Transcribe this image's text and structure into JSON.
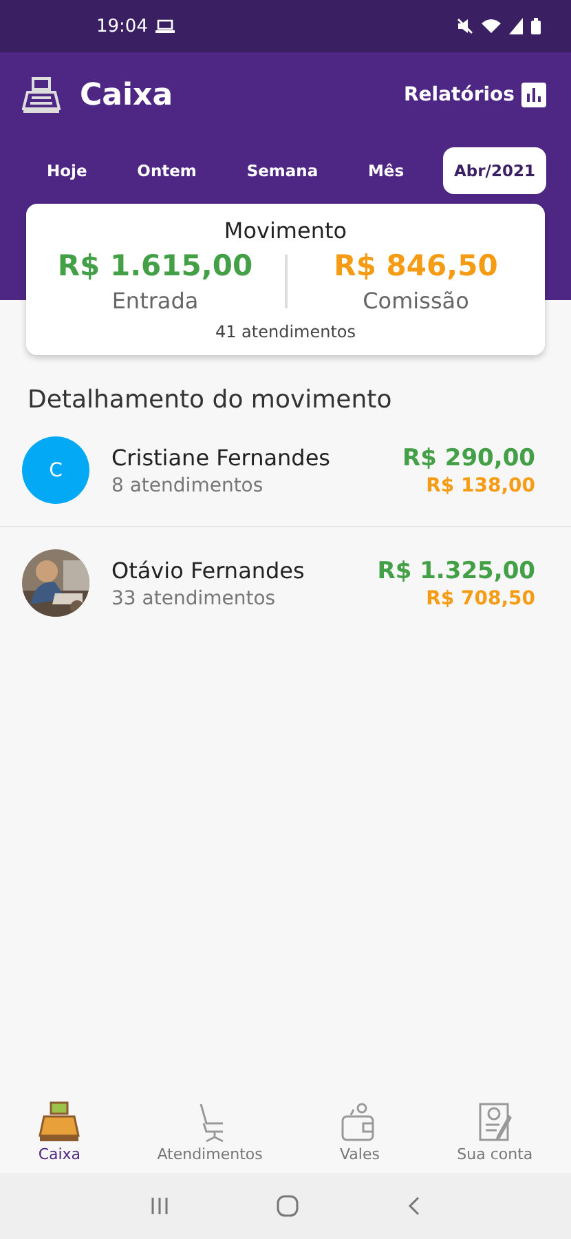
{
  "status_bar": {
    "time": "19:04"
  },
  "header": {
    "title": "Caixa",
    "reports_label": "Relatórios"
  },
  "tabs": [
    {
      "label": "Hoje",
      "selected": false
    },
    {
      "label": "Ontem",
      "selected": false
    },
    {
      "label": "Semana",
      "selected": false
    },
    {
      "label": "Mês",
      "selected": false
    },
    {
      "label": "Abr/2021",
      "selected": true
    }
  ],
  "summary": {
    "title": "Movimento",
    "income": "R$ 1.615,00",
    "income_label": "Entrada",
    "commission": "R$ 846,50",
    "commission_label": "Comissão",
    "count": "41 atendimentos"
  },
  "section_title": "Detalhamento do movimento",
  "professionals": [
    {
      "kind": "initial",
      "initial": "C",
      "color": "#03a9f4",
      "name": "Cristiane Fernandes",
      "count": "8 atendimentos",
      "income": "R$ 290,00",
      "commission": "R$ 138,00"
    },
    {
      "kind": "picture",
      "name": "Otávio Fernandes",
      "count": "33 atendimentos",
      "income": "R$ 1.325,00",
      "commission": "R$ 708,50"
    }
  ],
  "bottom_nav": [
    {
      "kind": "register",
      "label": "Caixa",
      "selected": true
    },
    {
      "kind": "chair",
      "label": "Atendimentos",
      "selected": false
    },
    {
      "kind": "wallet",
      "label": "Vales",
      "selected": false
    },
    {
      "kind": "document",
      "label": "Sua conta",
      "selected": false
    }
  ]
}
